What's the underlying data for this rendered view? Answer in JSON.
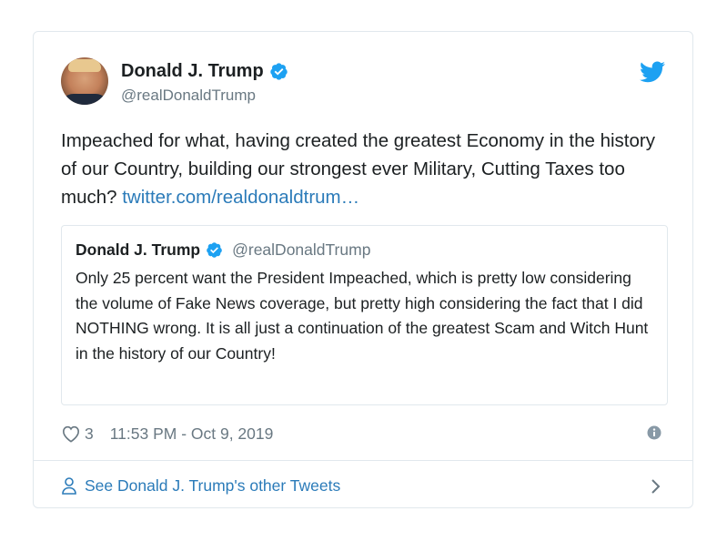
{
  "tweet": {
    "author_name": "Donald J. Trump",
    "author_handle": "@realDonaldTrump",
    "text": "Impeached for what, having created the greatest Economy in the history of our Country, building our strongest ever Military, Cutting Taxes too much?",
    "link_text": "twitter.com/realdonaldtrum…",
    "likes": "3",
    "timestamp": "11:53 PM - Oct 9, 2019"
  },
  "quoted_tweet": {
    "author_name": "Donald J. Trump",
    "author_handle": "@realDonaldTrump",
    "text": "Only 25 percent want the President Impeached, which is pretty low considering the volume of Fake News coverage, but pretty high considering the fact that I did NOTHING wrong. It is all just a continuation of the greatest Scam and Witch Hunt in the history of our Country!"
  },
  "footer": {
    "label": "See Donald J. Trump's other Tweets"
  },
  "colors": {
    "accent": "#2b7bb9",
    "twitter_blue": "#1da1f2",
    "muted": "#697882",
    "border": "#e1e8ed"
  },
  "icons": [
    "avatar",
    "verified-badge-icon",
    "twitter-bird-icon",
    "heart-icon",
    "info-icon",
    "person-icon",
    "chevron-right-icon"
  ]
}
